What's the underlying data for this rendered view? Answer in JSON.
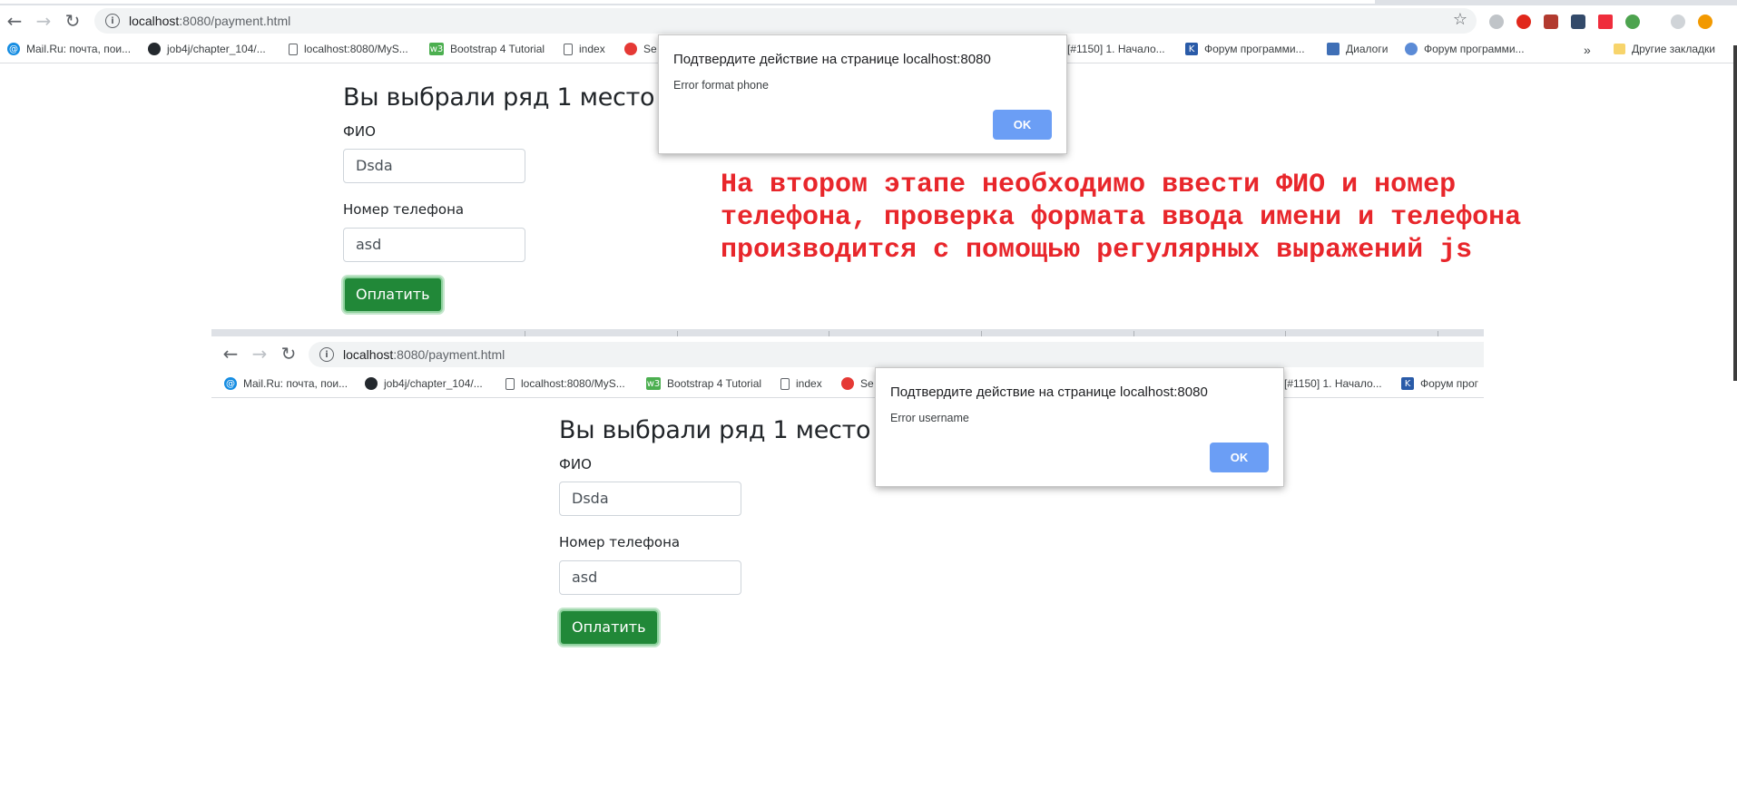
{
  "browser1": {
    "url_host": "localhost",
    "url_path": ":8080/payment.html",
    "bookmarks": [
      {
        "label": "Mail.Ru: почта, пои...",
        "icon": "mailru-icon",
        "color": "#168de2"
      },
      {
        "label": "job4j/chapter_104/...",
        "icon": "github-icon",
        "color": "#24292e"
      },
      {
        "label": "localhost:8080/MyS...",
        "icon": "page-icon",
        "color": "#ffffff"
      },
      {
        "label": "Bootstrap 4 Tutorial",
        "icon": "w3-icon",
        "color": "#4caf50"
      },
      {
        "label": "index",
        "icon": "page-icon",
        "color": "#ffffff"
      },
      {
        "label": "Se",
        "icon": "site-icon",
        "color": "#e53935"
      },
      {
        "label": "[#1150] 1. Начало...",
        "icon": "none",
        "color": "#ffffff"
      },
      {
        "label": "Форум программи...",
        "icon": "forum-icon",
        "color": "#2a5ba8"
      },
      {
        "label": "Диалоги",
        "icon": "dialog-icon",
        "color": "#3f6fb6"
      },
      {
        "label": "Форум программи...",
        "icon": "network-icon",
        "color": "#5b8bd6"
      }
    ],
    "more_label": "»",
    "other_bookmarks": "Другие закладки"
  },
  "form1": {
    "heading": "Вы выбрали ряд 1 место 1,",
    "fio_label": "ФИО",
    "fio_value": "Dsda",
    "phone_label": "Номер телефона",
    "phone_value": "asd",
    "pay_button": "Оплатить"
  },
  "dialog1": {
    "title": "Подтвердите действие на странице localhost:8080",
    "message": "Error format phone",
    "ok": "OK"
  },
  "annotation": {
    "text": "На втором этапе необходимо ввести ФИО и номер\nтелефона, проверка формата ввода имени и телефона\nпроизводится с помощью регулярных выражений  js"
  },
  "browser2": {
    "url_host": "localhost",
    "url_path": ":8080/payment.html",
    "bookmarks": [
      {
        "label": "Mail.Ru: почта, пои...",
        "icon": "mailru-icon",
        "color": "#168de2"
      },
      {
        "label": "job4j/chapter_104/...",
        "icon": "github-icon",
        "color": "#24292e"
      },
      {
        "label": "localhost:8080/MyS...",
        "icon": "page-icon",
        "color": "#ffffff"
      },
      {
        "label": "Bootstrap 4 Tutorial",
        "icon": "w3-icon",
        "color": "#4caf50"
      },
      {
        "label": "index",
        "icon": "page-icon",
        "color": "#ffffff"
      },
      {
        "label": "Se",
        "icon": "site-icon",
        "color": "#e53935"
      },
      {
        "label": "[#1150] 1. Начало...",
        "icon": "none",
        "color": "#ffffff"
      },
      {
        "label": "Форум прог",
        "icon": "forum-icon",
        "color": "#2a5ba8"
      }
    ]
  },
  "form2": {
    "heading": "Вы выбрали ряд 1 место 1,",
    "fio_label": "ФИО",
    "fio_value": "Dsda",
    "phone_label": "Номер телефона",
    "phone_value": "asd",
    "pay_button": "Оплатить"
  },
  "dialog2": {
    "title": "Подтвердите действие на странице localhost:8080",
    "message": "Error username",
    "ok": "OK"
  }
}
